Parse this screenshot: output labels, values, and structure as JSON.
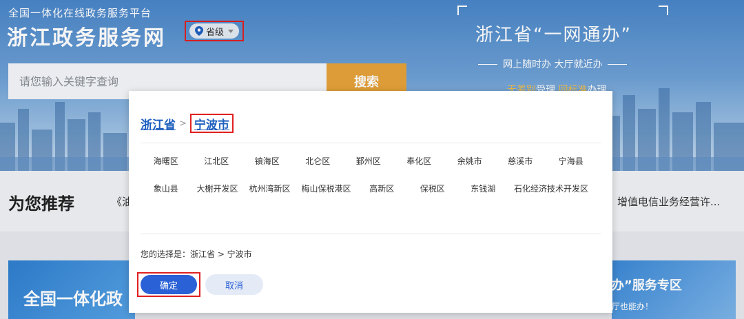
{
  "header": {
    "platform_subtitle": "全国一体化在线政务服务平台",
    "site_title": "浙江政务服务网",
    "region_level": "省级",
    "search_placeholder": "请您输入关键字查询",
    "search_button": "搜索"
  },
  "promo": {
    "title": "浙江省“一网通办”",
    "tagline": "网上随时办  大厅就近办",
    "slogan_highlight_1": "无差别",
    "slogan_text_1": "受理",
    "slogan_highlight_2": "同标准",
    "slogan_text_2": "办理"
  },
  "recommend": {
    "title": "为您推荐",
    "left_item": "《油",
    "right_item": "增值电信业务经营许..."
  },
  "cards": {
    "left_title": "全国一体化政",
    "right_title": "办”服务专区",
    "right_subtitle": "厅也能办！"
  },
  "modal": {
    "crumb_province": "浙江省",
    "crumb_separator": ">",
    "crumb_city": "宁波市",
    "districts": [
      "海曙区",
      "江北区",
      "镇海区",
      "北仑区",
      "鄞州区",
      "奉化区",
      "余姚市",
      "慈溪市",
      "宁海县",
      "象山县",
      "大榭开发区",
      "杭州湾新区",
      "梅山保税港区",
      "高新区",
      "保税区",
      "东钱湖",
      "石化经济技术开发区"
    ],
    "selection_text": "您的选择是：浙江省 > 宁波市",
    "confirm_button": "确定",
    "cancel_button": "取消"
  },
  "colors": {
    "accent_blue": "#2a61d6",
    "search_orange": "#e7a33a",
    "highlight_red": "#e02020"
  }
}
